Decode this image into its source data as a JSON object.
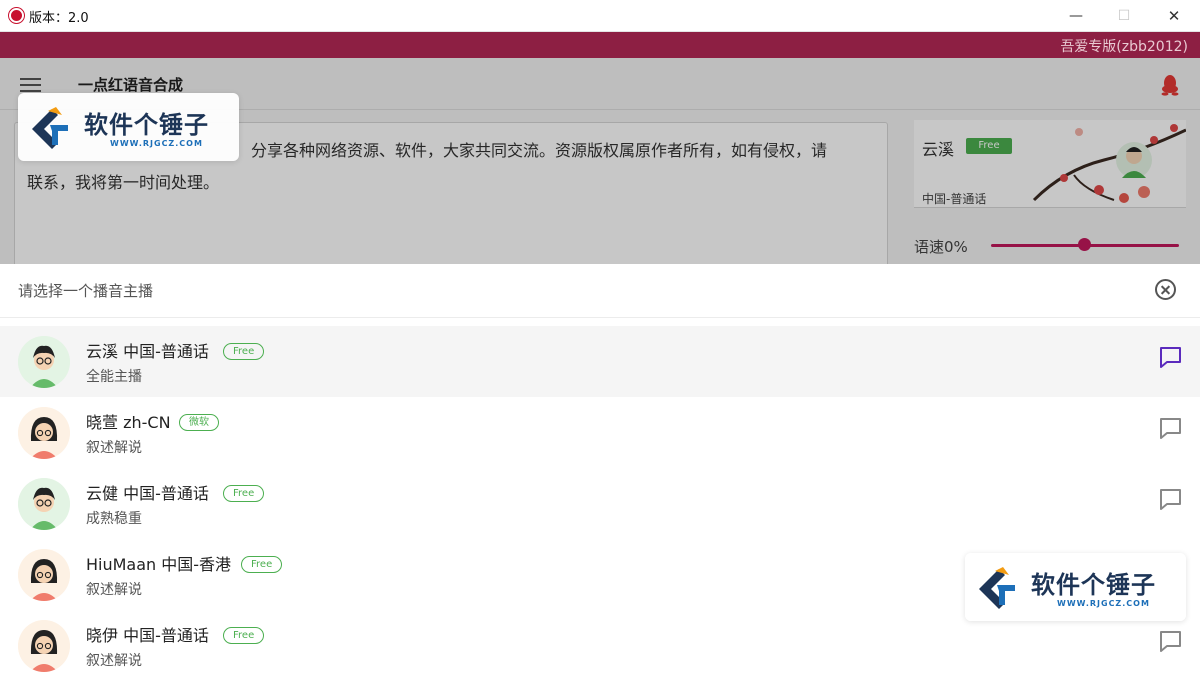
{
  "window": {
    "title": "版本：2.0",
    "controls": {
      "minimize": "—",
      "maximize": "☐",
      "close": "✕"
    }
  },
  "banner": {
    "text": "吾爱专版(zbb2012)"
  },
  "toolbar": {
    "app_name": "一点红语音合成",
    "menu_icon": "menu-icon",
    "qq_icon": "qq-penguin-icon"
  },
  "editor": {
    "line1": "　　　　　　　　　　　　　　分享各种网络资源、软件，大家共同交流。资源版权属原作者所有，如有侵权，请",
    "line2": "联系，我将第一时间处理。"
  },
  "current_anchor": {
    "name": "云溪",
    "badge": "Free",
    "language": "中国-普通话"
  },
  "speed": {
    "label": "语速0%",
    "value": 0.5,
    "accent": "#c2185b"
  },
  "watermark": {
    "title": "软件个锤子",
    "url": "WWW.RJGCZ.COM"
  },
  "sheet": {
    "title": "请选择一个播音主播",
    "close_icon": "close-circle-icon",
    "anchors": [
      {
        "name": "云溪 中国-普通话",
        "tag": "Free",
        "desc": "全能主播",
        "avatar": "male",
        "selected": true
      },
      {
        "name": "晓萱 zh-CN",
        "tag": "微软",
        "desc": "叙述解说",
        "avatar": "female",
        "selected": false
      },
      {
        "name": "云健 中国-普通话",
        "tag": "Free",
        "desc": "成熟稳重",
        "avatar": "male",
        "selected": false
      },
      {
        "name": "HiuMaan 中国-香港",
        "tag": "Free",
        "desc": "叙述解说",
        "avatar": "female",
        "selected": false
      },
      {
        "name": "晓伊 中国-普通话",
        "tag": "Free",
        "desc": "叙述解说",
        "avatar": "female",
        "selected": false
      }
    ]
  },
  "colors": {
    "banner": "#8d1f43",
    "badge_green": "#4caf50",
    "selected_chat": "#5b2bbd"
  }
}
